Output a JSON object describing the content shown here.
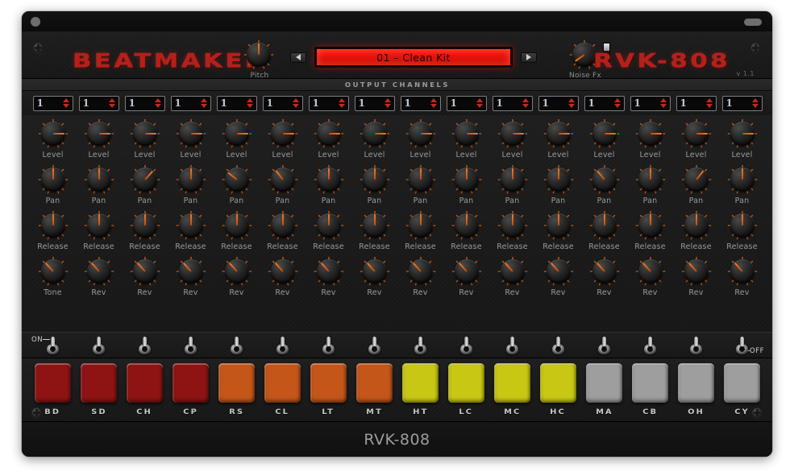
{
  "window": {
    "close_button": "close",
    "resize_pill": "resize"
  },
  "header": {
    "brand_left": "BEATMAKER",
    "brand_right": "RVK-808",
    "version": "v 1.1",
    "pitch_label": "Pitch",
    "noise_label": "Noise Fx",
    "prev_label": "◀",
    "next_label": "▶",
    "preset_value": "01 – Clean Kit"
  },
  "output_channels": {
    "title": "OUTPUT CHANNELS",
    "values": [
      "1",
      "1",
      "1",
      "1",
      "1",
      "1",
      "1",
      "1",
      "1",
      "1",
      "1",
      "1",
      "1",
      "1",
      "1",
      "1"
    ]
  },
  "knob_rows": [
    {
      "row_name": "level",
      "labels": [
        "Level",
        "Level",
        "Level",
        "Level",
        "Level",
        "Level",
        "Level",
        "Level",
        "Level",
        "Level",
        "Level",
        "Level",
        "Level",
        "Level",
        "Level",
        "Level"
      ],
      "angles": [
        90,
        90,
        90,
        90,
        90,
        90,
        90,
        90,
        90,
        90,
        90,
        90,
        90,
        90,
        90,
        90
      ]
    },
    {
      "row_name": "pan",
      "labels": [
        "Pan",
        "Pan",
        "Pan",
        "Pan",
        "Pan",
        "Pan",
        "Pan",
        "Pan",
        "Pan",
        "Pan",
        "Pan",
        "Pan",
        "Pan",
        "Pan",
        "Pan",
        "Pan"
      ],
      "angles": [
        0,
        0,
        42,
        0,
        -52,
        -38,
        0,
        0,
        0,
        0,
        0,
        0,
        -40,
        0,
        38,
        0
      ]
    },
    {
      "row_name": "release",
      "labels": [
        "Release",
        "Release",
        "Release",
        "Release",
        "Release",
        "Release",
        "Release",
        "Release",
        "Release",
        "Release",
        "Release",
        "Release",
        "Release",
        "Release",
        "Release",
        "Release"
      ],
      "angles": [
        0,
        0,
        0,
        0,
        0,
        0,
        0,
        0,
        0,
        0,
        0,
        0,
        0,
        0,
        0,
        0
      ]
    },
    {
      "row_name": "tone-rev",
      "labels": [
        "Tone",
        "Rev",
        "Rev",
        "Rev",
        "Rev",
        "Rev",
        "Rev",
        "Rev",
        "Rev",
        "Rev",
        "Rev",
        "Rev",
        "Rev",
        "Rev",
        "Rev",
        "Rev"
      ],
      "angles": [
        -42,
        -42,
        -42,
        -42,
        -42,
        -42,
        -42,
        -42,
        -42,
        -42,
        -42,
        -42,
        -42,
        -42,
        -42,
        -42
      ]
    }
  ],
  "switch_row": {
    "on_label": "ON",
    "off_label": "OFF",
    "count": 16
  },
  "pads": [
    {
      "label": "BD",
      "color": "#8e1414"
    },
    {
      "label": "SD",
      "color": "#8e1414"
    },
    {
      "label": "CH",
      "color": "#8e1414"
    },
    {
      "label": "CP",
      "color": "#8e1414"
    },
    {
      "label": "RS",
      "color": "#c4561a"
    },
    {
      "label": "CL",
      "color": "#c4561a"
    },
    {
      "label": "LT",
      "color": "#c4561a"
    },
    {
      "label": "MT",
      "color": "#c4561a"
    },
    {
      "label": "HT",
      "color": "#c8c714"
    },
    {
      "label": "LC",
      "color": "#c8c714"
    },
    {
      "label": "MC",
      "color": "#c8c714"
    },
    {
      "label": "HC",
      "color": "#c8c714"
    },
    {
      "label": "MA",
      "color": "#9e9e9e"
    },
    {
      "label": "CB",
      "color": "#9e9e9e"
    },
    {
      "label": "OH",
      "color": "#9e9e9e"
    },
    {
      "label": "CY",
      "color": "#9e9e9e"
    }
  ],
  "footer": {
    "title": "RVK-808"
  },
  "colors": {
    "accent_red": "#b4201c",
    "accent_orange": "#ff7a20",
    "display_red": "#ff1a12",
    "panel_dark": "#1b1b1b"
  }
}
